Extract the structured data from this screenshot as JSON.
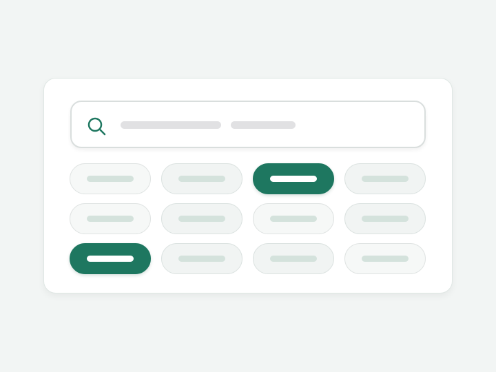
{
  "colors": {
    "background": "#f2f5f4",
    "card": "#ffffff",
    "accent": "#1e7760",
    "placeholder": "#e1e1e3",
    "chip_bar": "#d4e2dc"
  },
  "search": {
    "icon": "search-icon"
  },
  "filter_grid": {
    "rows": [
      [
        {
          "selected": false
        },
        {
          "selected": false
        },
        {
          "selected": true
        },
        {
          "selected": false
        }
      ],
      [
        {
          "selected": false
        },
        {
          "selected": false
        },
        {
          "selected": false
        },
        {
          "selected": false
        }
      ],
      [
        {
          "selected": true
        },
        {
          "selected": false
        },
        {
          "selected": false
        },
        {
          "selected": false
        }
      ]
    ]
  }
}
